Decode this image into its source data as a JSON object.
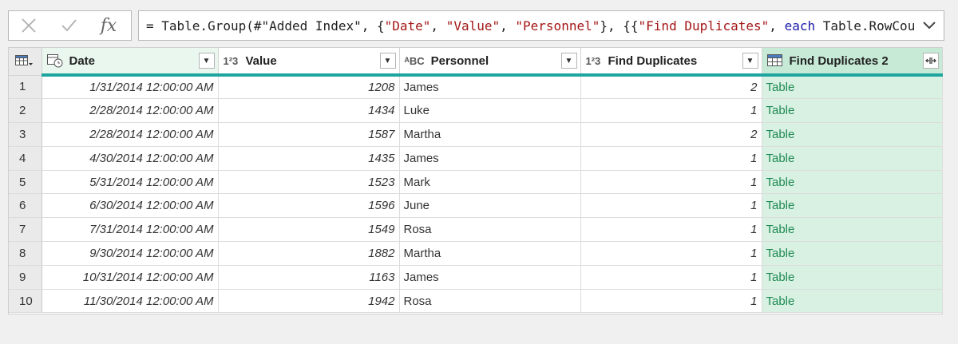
{
  "formula_bar": {
    "cancel_icon": "x-icon",
    "commit_icon": "check-icon",
    "fx_label": "fx",
    "formula_parts": [
      {
        "text": "= Table.Group(#\"Added Index\", {",
        "kind": "plain"
      },
      {
        "text": "\"Date\"",
        "kind": "str"
      },
      {
        "text": ", ",
        "kind": "plain"
      },
      {
        "text": "\"Value\"",
        "kind": "str"
      },
      {
        "text": ", ",
        "kind": "plain"
      },
      {
        "text": "\"Personnel\"",
        "kind": "str"
      },
      {
        "text": "}, {{",
        "kind": "plain"
      },
      {
        "text": "\"Find Duplicates\"",
        "kind": "str"
      },
      {
        "text": ", ",
        "kind": "plain"
      },
      {
        "text": "each",
        "kind": "kw"
      },
      {
        "text": " Table.RowCount",
        "kind": "plain"
      }
    ]
  },
  "columns": [
    {
      "label": "Date",
      "type_icon": "date-time-icon"
    },
    {
      "label": "Value",
      "type_icon": "number-icon",
      "type_glyph": "1²3"
    },
    {
      "label": "Personnel",
      "type_icon": "text-icon",
      "type_glyph": "ᴬBC"
    },
    {
      "label": "Find Duplicates",
      "type_icon": "number-icon",
      "type_glyph": "1²3"
    },
    {
      "label": "Find Duplicates 2",
      "type_icon": "table-icon"
    }
  ],
  "rows": [
    {
      "n": "1",
      "date": "1/31/2014 12:00:00 AM",
      "value": "1208",
      "personnel": "James",
      "dup": "2",
      "dup2": "Table"
    },
    {
      "n": "2",
      "date": "2/28/2014 12:00:00 AM",
      "value": "1434",
      "personnel": "Luke",
      "dup": "1",
      "dup2": "Table"
    },
    {
      "n": "3",
      "date": "2/28/2014 12:00:00 AM",
      "value": "1587",
      "personnel": "Martha",
      "dup": "2",
      "dup2": "Table"
    },
    {
      "n": "4",
      "date": "4/30/2014 12:00:00 AM",
      "value": "1435",
      "personnel": "James",
      "dup": "1",
      "dup2": "Table"
    },
    {
      "n": "5",
      "date": "5/31/2014 12:00:00 AM",
      "value": "1523",
      "personnel": "Mark",
      "dup": "1",
      "dup2": "Table"
    },
    {
      "n": "6",
      "date": "6/30/2014 12:00:00 AM",
      "value": "1596",
      "personnel": "June",
      "dup": "1",
      "dup2": "Table"
    },
    {
      "n": "7",
      "date": "7/31/2014 12:00:00 AM",
      "value": "1549",
      "personnel": "Rosa",
      "dup": "1",
      "dup2": "Table"
    },
    {
      "n": "8",
      "date": "9/30/2014 12:00:00 AM",
      "value": "1882",
      "personnel": "Martha",
      "dup": "1",
      "dup2": "Table"
    },
    {
      "n": "9",
      "date": "10/31/2014 12:00:00 AM",
      "value": "1163",
      "personnel": "James",
      "dup": "1",
      "dup2": "Table"
    },
    {
      "n": "10",
      "date": "11/30/2014 12:00:00 AM",
      "value": "1942",
      "personnel": "Rosa",
      "dup": "1",
      "dup2": "Table"
    }
  ],
  "colors": {
    "accent_teal": "#1fa5a0",
    "selected_column_bg": "#d9f1e3",
    "table_link": "#1e8a52"
  }
}
